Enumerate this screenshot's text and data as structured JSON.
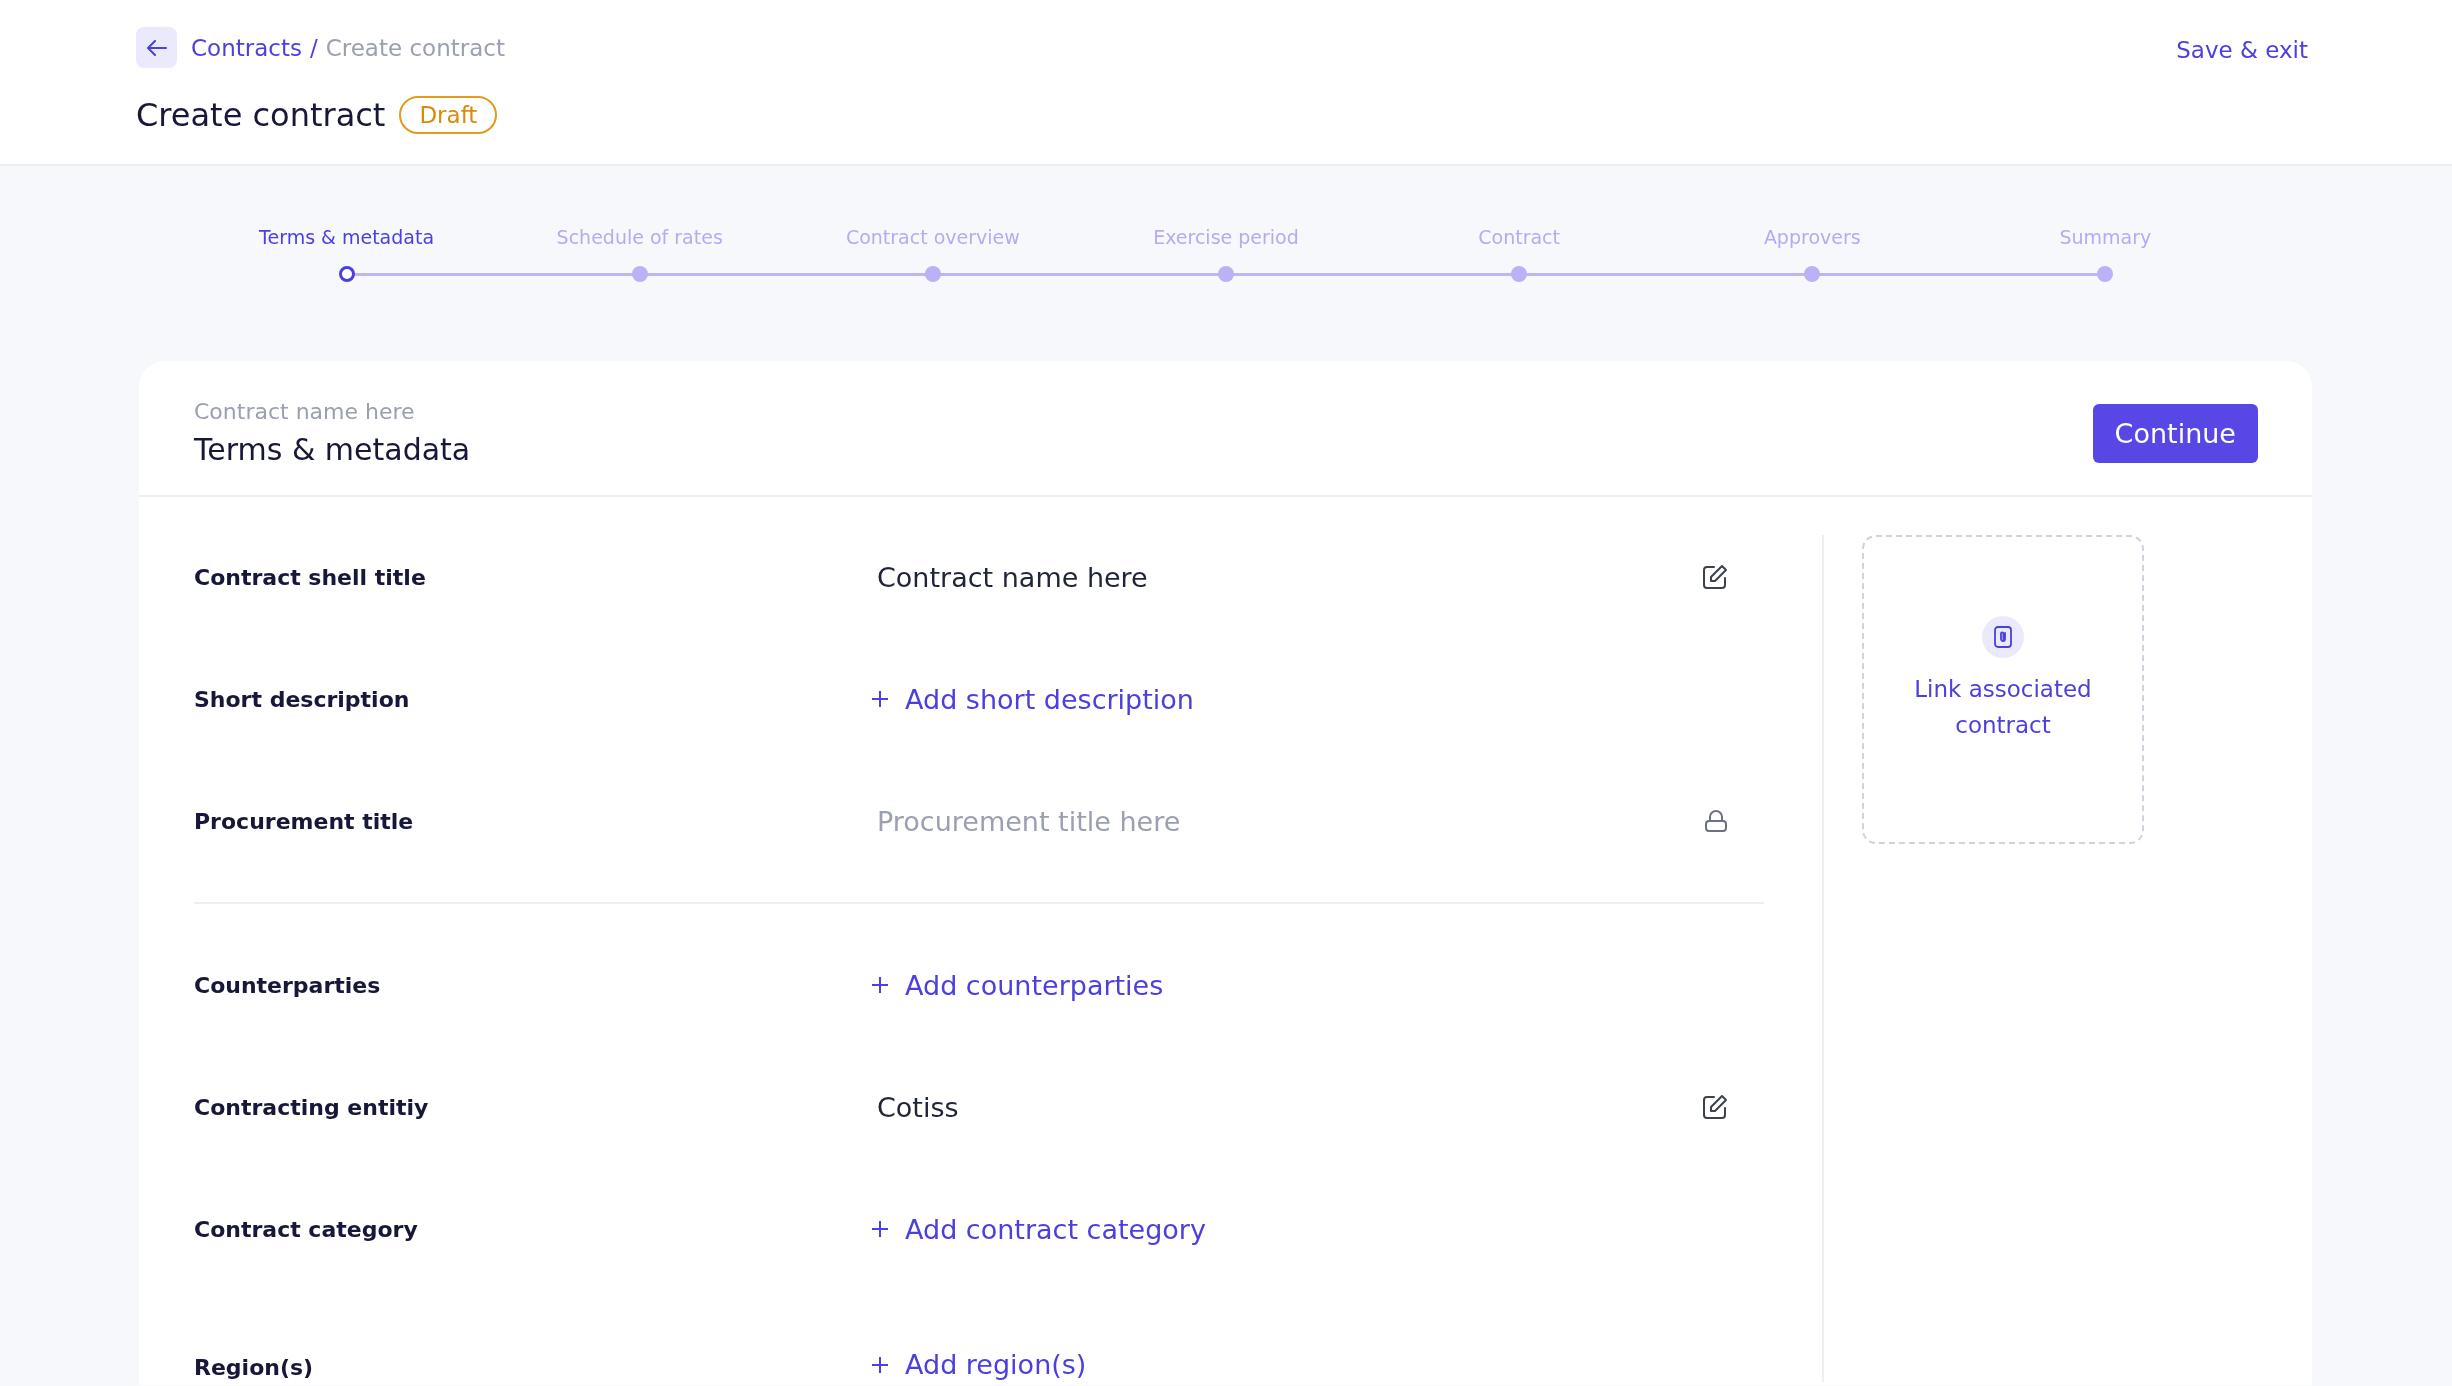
{
  "breadcrumb": {
    "items": [
      {
        "text": "Contracts",
        "kind": "link"
      },
      {
        "text": "Create contract",
        "kind": "current"
      }
    ],
    "separator": "/"
  },
  "page_title": "Create contract",
  "status_badge": "Draft",
  "save_exit": "Save & exit",
  "steps": [
    {
      "label": "Terms & metadata",
      "selected": true
    },
    {
      "label": "Schedule of rates",
      "selected": false
    },
    {
      "label": "Contract overview",
      "selected": false
    },
    {
      "label": "Exercise period",
      "selected": false
    },
    {
      "label": "Contract",
      "selected": false
    },
    {
      "label": "Approvers",
      "selected": false
    },
    {
      "label": "Summary",
      "selected": false
    }
  ],
  "card": {
    "subtitle": "Contract name here",
    "title": "Terms & metadata",
    "primary_button": "Continue"
  },
  "field_groups": [
    [
      {
        "label": "Contract shell title",
        "kind": "editable",
        "value": "Contract name here"
      },
      {
        "label": "Short description",
        "kind": "add",
        "action": "Add short description"
      },
      {
        "label": "Procurement title",
        "kind": "locked",
        "value": "Procurement title here"
      }
    ],
    [
      {
        "label": "Counterparties",
        "kind": "add",
        "action": "Add counterparties"
      },
      {
        "label": "Contracting entitiy",
        "kind": "editable",
        "value": "Cotiss"
      },
      {
        "label": "Contract category",
        "kind": "add",
        "action": "Add contract category"
      },
      {
        "label": "Region(s)",
        "kind": "add",
        "action": "Add region(s)"
      }
    ]
  ],
  "side_action": "Link associated contract"
}
